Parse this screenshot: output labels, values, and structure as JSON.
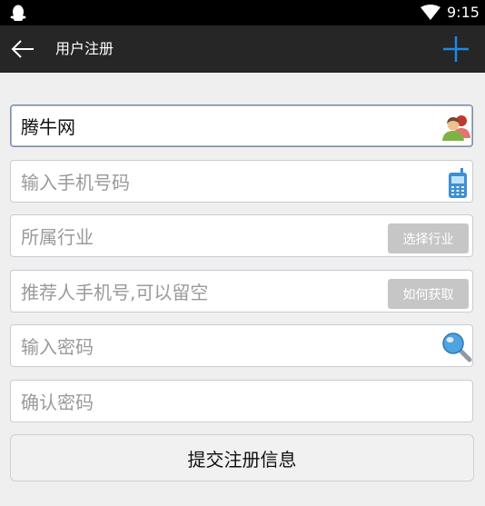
{
  "status_bar": {
    "time": "9:15",
    "icons": [
      "qq-penguin-icon",
      "wifi-icon"
    ]
  },
  "action_bar": {
    "title": "用户注册",
    "back_icon": "back-arrow-icon",
    "add_icon": "plus-icon",
    "accent_color": "#1e88e5"
  },
  "form": {
    "username": {
      "value": "腾牛网",
      "icon": "user-avatar-icon"
    },
    "phone": {
      "placeholder": "输入手机号码",
      "icon": "mobile-phone-icon"
    },
    "industry": {
      "placeholder": "所属行业",
      "button_label": "选择行业"
    },
    "referrer": {
      "placeholder": "推荐人手机号,可以留空",
      "button_label": "如何获取"
    },
    "password": {
      "placeholder": "输入密码",
      "icon": "key-search-icon"
    },
    "confirm_password": {
      "placeholder": "确认密码"
    },
    "submit_label": "提交注册信息"
  },
  "colors": {
    "background": "#efefef",
    "status_bar": "#000000",
    "action_bar": "#262626",
    "side_button": "#c6c6c6"
  }
}
